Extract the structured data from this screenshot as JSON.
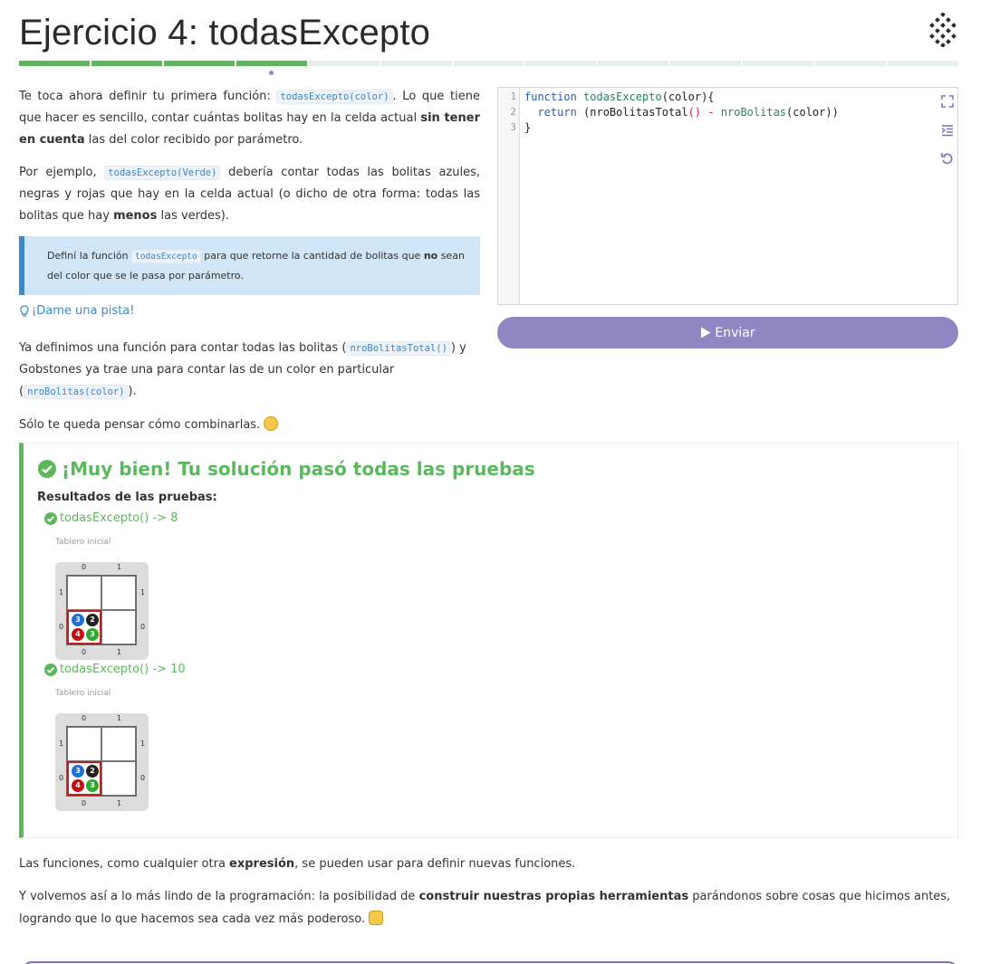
{
  "page": {
    "title": "Ejercicio 4: todasExcepto",
    "progress": {
      "segments": 13,
      "completed": 4,
      "current": 4
    }
  },
  "description": {
    "p1_a": "Te toca ahora definir tu primera función: ",
    "p1_code": "todasExcepto(color)",
    "p1_b": ". Lo que tiene que hacer es sencillo, contar cuántas bolitas hay en la celda actual ",
    "p1_bold": "sin tener en cuenta",
    "p1_c": " las del color recibido por parámetro.",
    "p2_a": "Por ejemplo, ",
    "p2_code": "todasExcepto(Verde)",
    "p2_b": " debería contar todas las bolitas azules, negras y rojas que hay en la celda actual (o dicho de otra forma: todas las bolitas que hay ",
    "p2_bold": "menos",
    "p2_c": " las verdes)."
  },
  "callout": {
    "a": "Definí la función ",
    "code": "todasExcepto",
    "b": " para que retorne la cantidad de bolitas que ",
    "bold": "no",
    "c": " sean del color que se le pasa por parámetro."
  },
  "hint": {
    "label": "¡Dame una pista!"
  },
  "hint_text": {
    "a": "Ya definimos una función para contar todas las bolitas (",
    "code1": "nroBolitasTotal()",
    "b": ") y Gobstones ya trae una para contar las de un color en particular (",
    "code2": "nroBolitas(color)",
    "c": ").",
    "p2": "Sólo te queda pensar cómo combinarlas. "
  },
  "editor": {
    "lines": [
      "1",
      "2",
      "3"
    ],
    "l1_kw": "function",
    "l1_fn": "todasExcepto",
    "l1_rest": "(color){",
    "l2_indent": "  ",
    "l2_kw": "return",
    "l2_a": " (nroBolitasTotal",
    "l2_op1": "()",
    "l2_op2": " - ",
    "l2_fn": "nroBolitas",
    "l2_b": "(color))",
    "l3": "}",
    "tools": [
      "expand-icon",
      "indent-icon",
      "undo-icon"
    ]
  },
  "submit": {
    "label": "Enviar"
  },
  "results": {
    "title": "¡Muy bien! Tu solución pasó todas las pruebas",
    "subtitle": "Resultados de las pruebas:",
    "tests": [
      {
        "label": "todasExcepto() -> 8",
        "board_label": "Tablero inicial",
        "cols": [
          "0",
          "1"
        ],
        "rows": [
          "1",
          "0"
        ],
        "balls": {
          "blue": "3",
          "black": "2",
          "red": "4",
          "green": "3"
        }
      },
      {
        "label": "todasExcepto() -> 10",
        "board_label": "Tablero inicial",
        "cols": [
          "0",
          "1"
        ],
        "rows": [
          "1",
          "0"
        ],
        "balls": {
          "blue": "3",
          "black": "2",
          "red": "4",
          "green": "3"
        }
      }
    ]
  },
  "footer": {
    "p1_a": "Las funciones, como cualquier otra ",
    "p1_bold": "expresión",
    "p1_b": ", se pueden usar para definir nuevas funciones.",
    "p2_a": "Y volvemos así a lo más lindo de la programación: la posibilidad de ",
    "p2_bold": "construir nuestras propias herramientas",
    "p2_b": " parándonos sobre cosas que hicimos antes, logrando que lo que hacemos sea cada vez más poderoso. "
  },
  "colors": {
    "accent": "#9087c2",
    "success": "#5cb85c",
    "info": "#3b8ac6"
  }
}
